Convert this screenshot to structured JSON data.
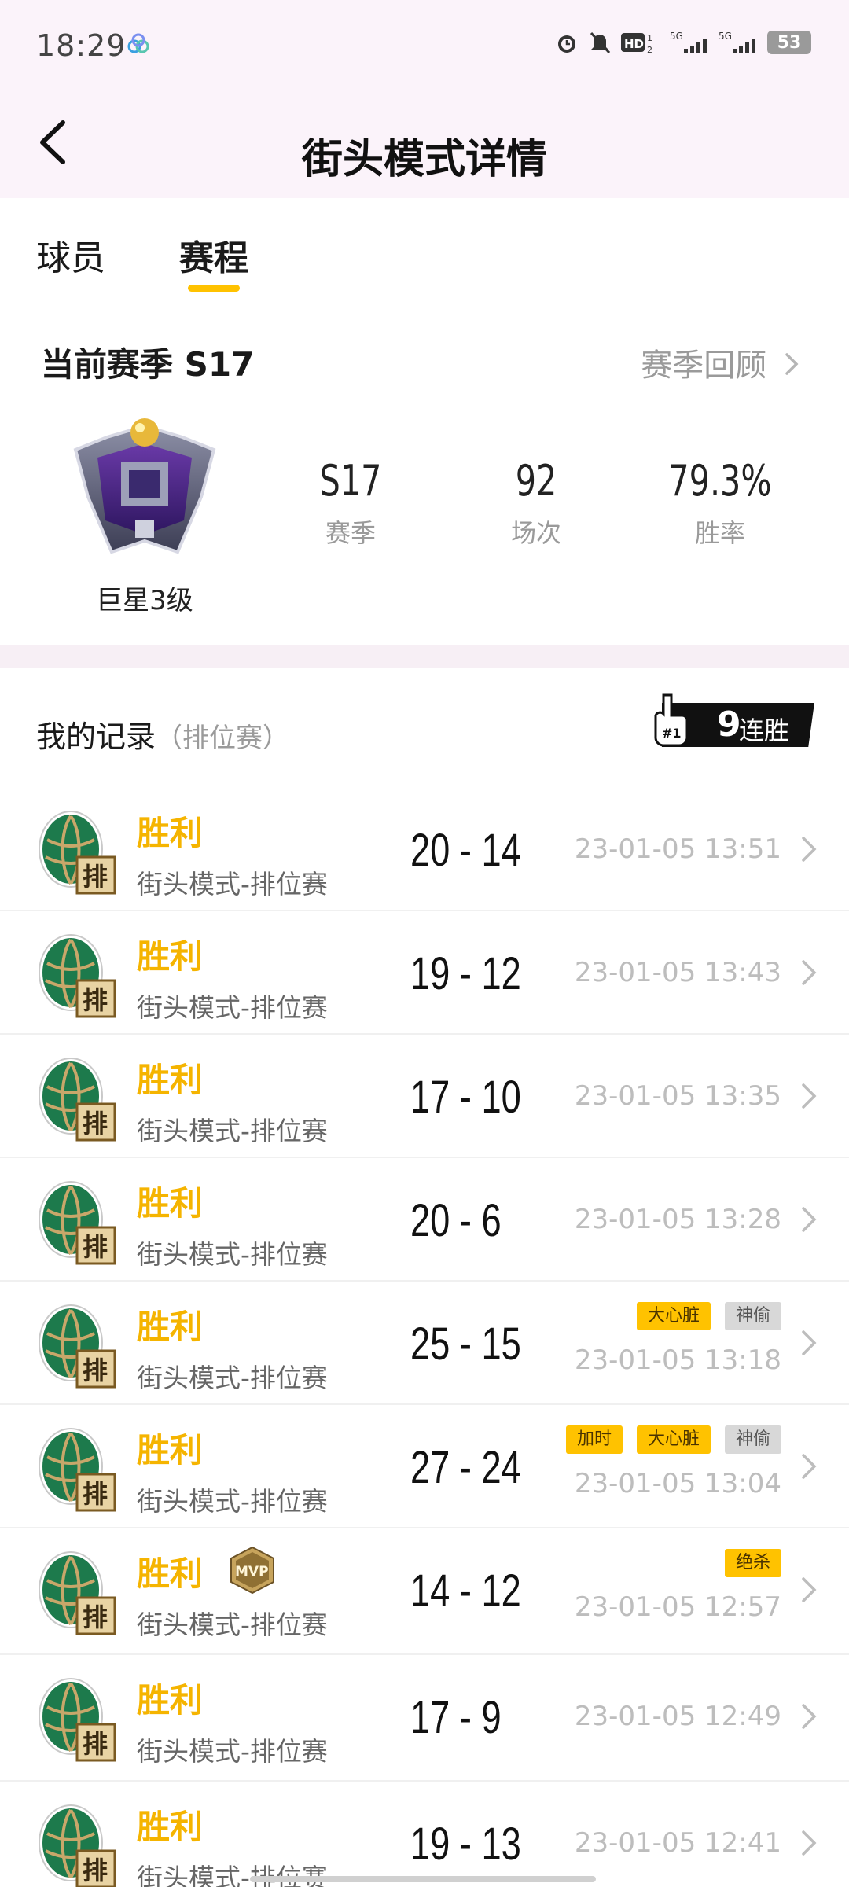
{
  "status_bar": {
    "time": "18:29",
    "icons": [
      "alarm-icon",
      "mute-icon",
      "hd-icon",
      "5g-signal-icon",
      "5g-signal-icon"
    ],
    "battery": "53"
  },
  "header": {
    "title": "街头模式详情"
  },
  "tabs": [
    {
      "label": "球员",
      "active": false
    },
    {
      "label": "赛程",
      "active": true
    }
  ],
  "season": {
    "title": "当前赛季 S17",
    "review_link": "赛季回顾",
    "rank_label": "巨星3级",
    "stats": [
      {
        "value": "S17",
        "label": "赛季"
      },
      {
        "value": "92",
        "label": "场次"
      },
      {
        "value": "79.3%",
        "label": "胜率"
      }
    ]
  },
  "records": {
    "title": "我的记录",
    "subtitle": "（排位赛）",
    "streak_num": "9",
    "streak_text": "连胜",
    "matches": [
      {
        "result": "胜利",
        "mode": "街头模式-排位赛",
        "score": "20 - 14",
        "time": "23-01-05 13:51",
        "tags": [],
        "mvp": false
      },
      {
        "result": "胜利",
        "mode": "街头模式-排位赛",
        "score": "19 - 12",
        "time": "23-01-05 13:43",
        "tags": [],
        "mvp": false
      },
      {
        "result": "胜利",
        "mode": "街头模式-排位赛",
        "score": "17 - 10",
        "time": "23-01-05 13:35",
        "tags": [],
        "mvp": false
      },
      {
        "result": "胜利",
        "mode": "街头模式-排位赛",
        "score": "20 - 6",
        "time": "23-01-05 13:28",
        "tags": [],
        "mvp": false
      },
      {
        "result": "胜利",
        "mode": "街头模式-排位赛",
        "score": "25 - 15",
        "time": "23-01-05 13:18",
        "tags": [
          {
            "text": "大心脏",
            "color": "yellow"
          },
          {
            "text": "神偷",
            "color": "grey"
          }
        ],
        "mvp": false
      },
      {
        "result": "胜利",
        "mode": "街头模式-排位赛",
        "score": "27 - 24",
        "time": "23-01-05 13:04",
        "tags": [
          {
            "text": "加时",
            "color": "yellow"
          },
          {
            "text": "大心脏",
            "color": "yellow"
          },
          {
            "text": "神偷",
            "color": "grey"
          }
        ],
        "mvp": false
      },
      {
        "result": "胜利",
        "mode": "街头模式-排位赛",
        "score": "14 - 12",
        "time": "23-01-05 12:57",
        "tags": [
          {
            "text": "绝杀",
            "color": "yellow"
          }
        ],
        "mvp": true
      },
      {
        "result": "胜利",
        "mode": "街头模式-排位赛",
        "score": "17 - 9",
        "time": "23-01-05 12:49",
        "tags": [],
        "mvp": false
      },
      {
        "result": "胜利",
        "mode": "街头模式-排位赛",
        "score": "19 - 13",
        "time": "23-01-05 12:41",
        "tags": [],
        "mvp": false
      }
    ],
    "mvp_text": "MVP",
    "logo_text": "排"
  },
  "colors": {
    "accent": "#ffc200",
    "win": "#f5b400",
    "header_bg": "#fbf3fa"
  }
}
